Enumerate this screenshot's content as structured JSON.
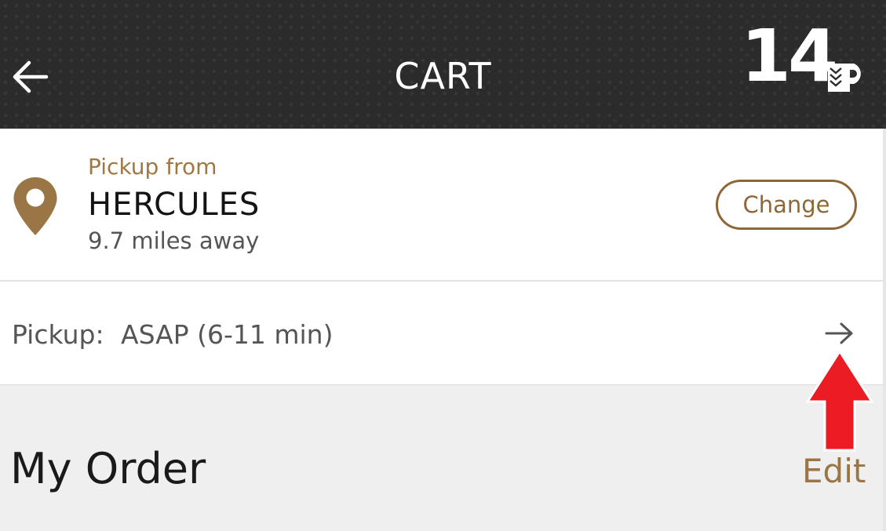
{
  "header": {
    "title": "CART",
    "points": "14",
    "back_icon": "arrow-left-icon",
    "points_logo_icon": "rewards-p-logo-icon"
  },
  "store": {
    "pickup_from_label": "Pickup from",
    "name": "HERCULES",
    "distance": "9.7 miles away",
    "change_label": "Change",
    "location_icon": "map-pin-icon"
  },
  "pickup": {
    "label": "Pickup:",
    "value": "ASAP (6-11 min)",
    "arrow_icon": "arrow-right-icon"
  },
  "order": {
    "title": "My Order",
    "edit_label": "Edit"
  },
  "colors": {
    "header_bg": "#2c2b2c",
    "accent": "#9a7647",
    "annotation_arrow": "#ec1c24"
  }
}
